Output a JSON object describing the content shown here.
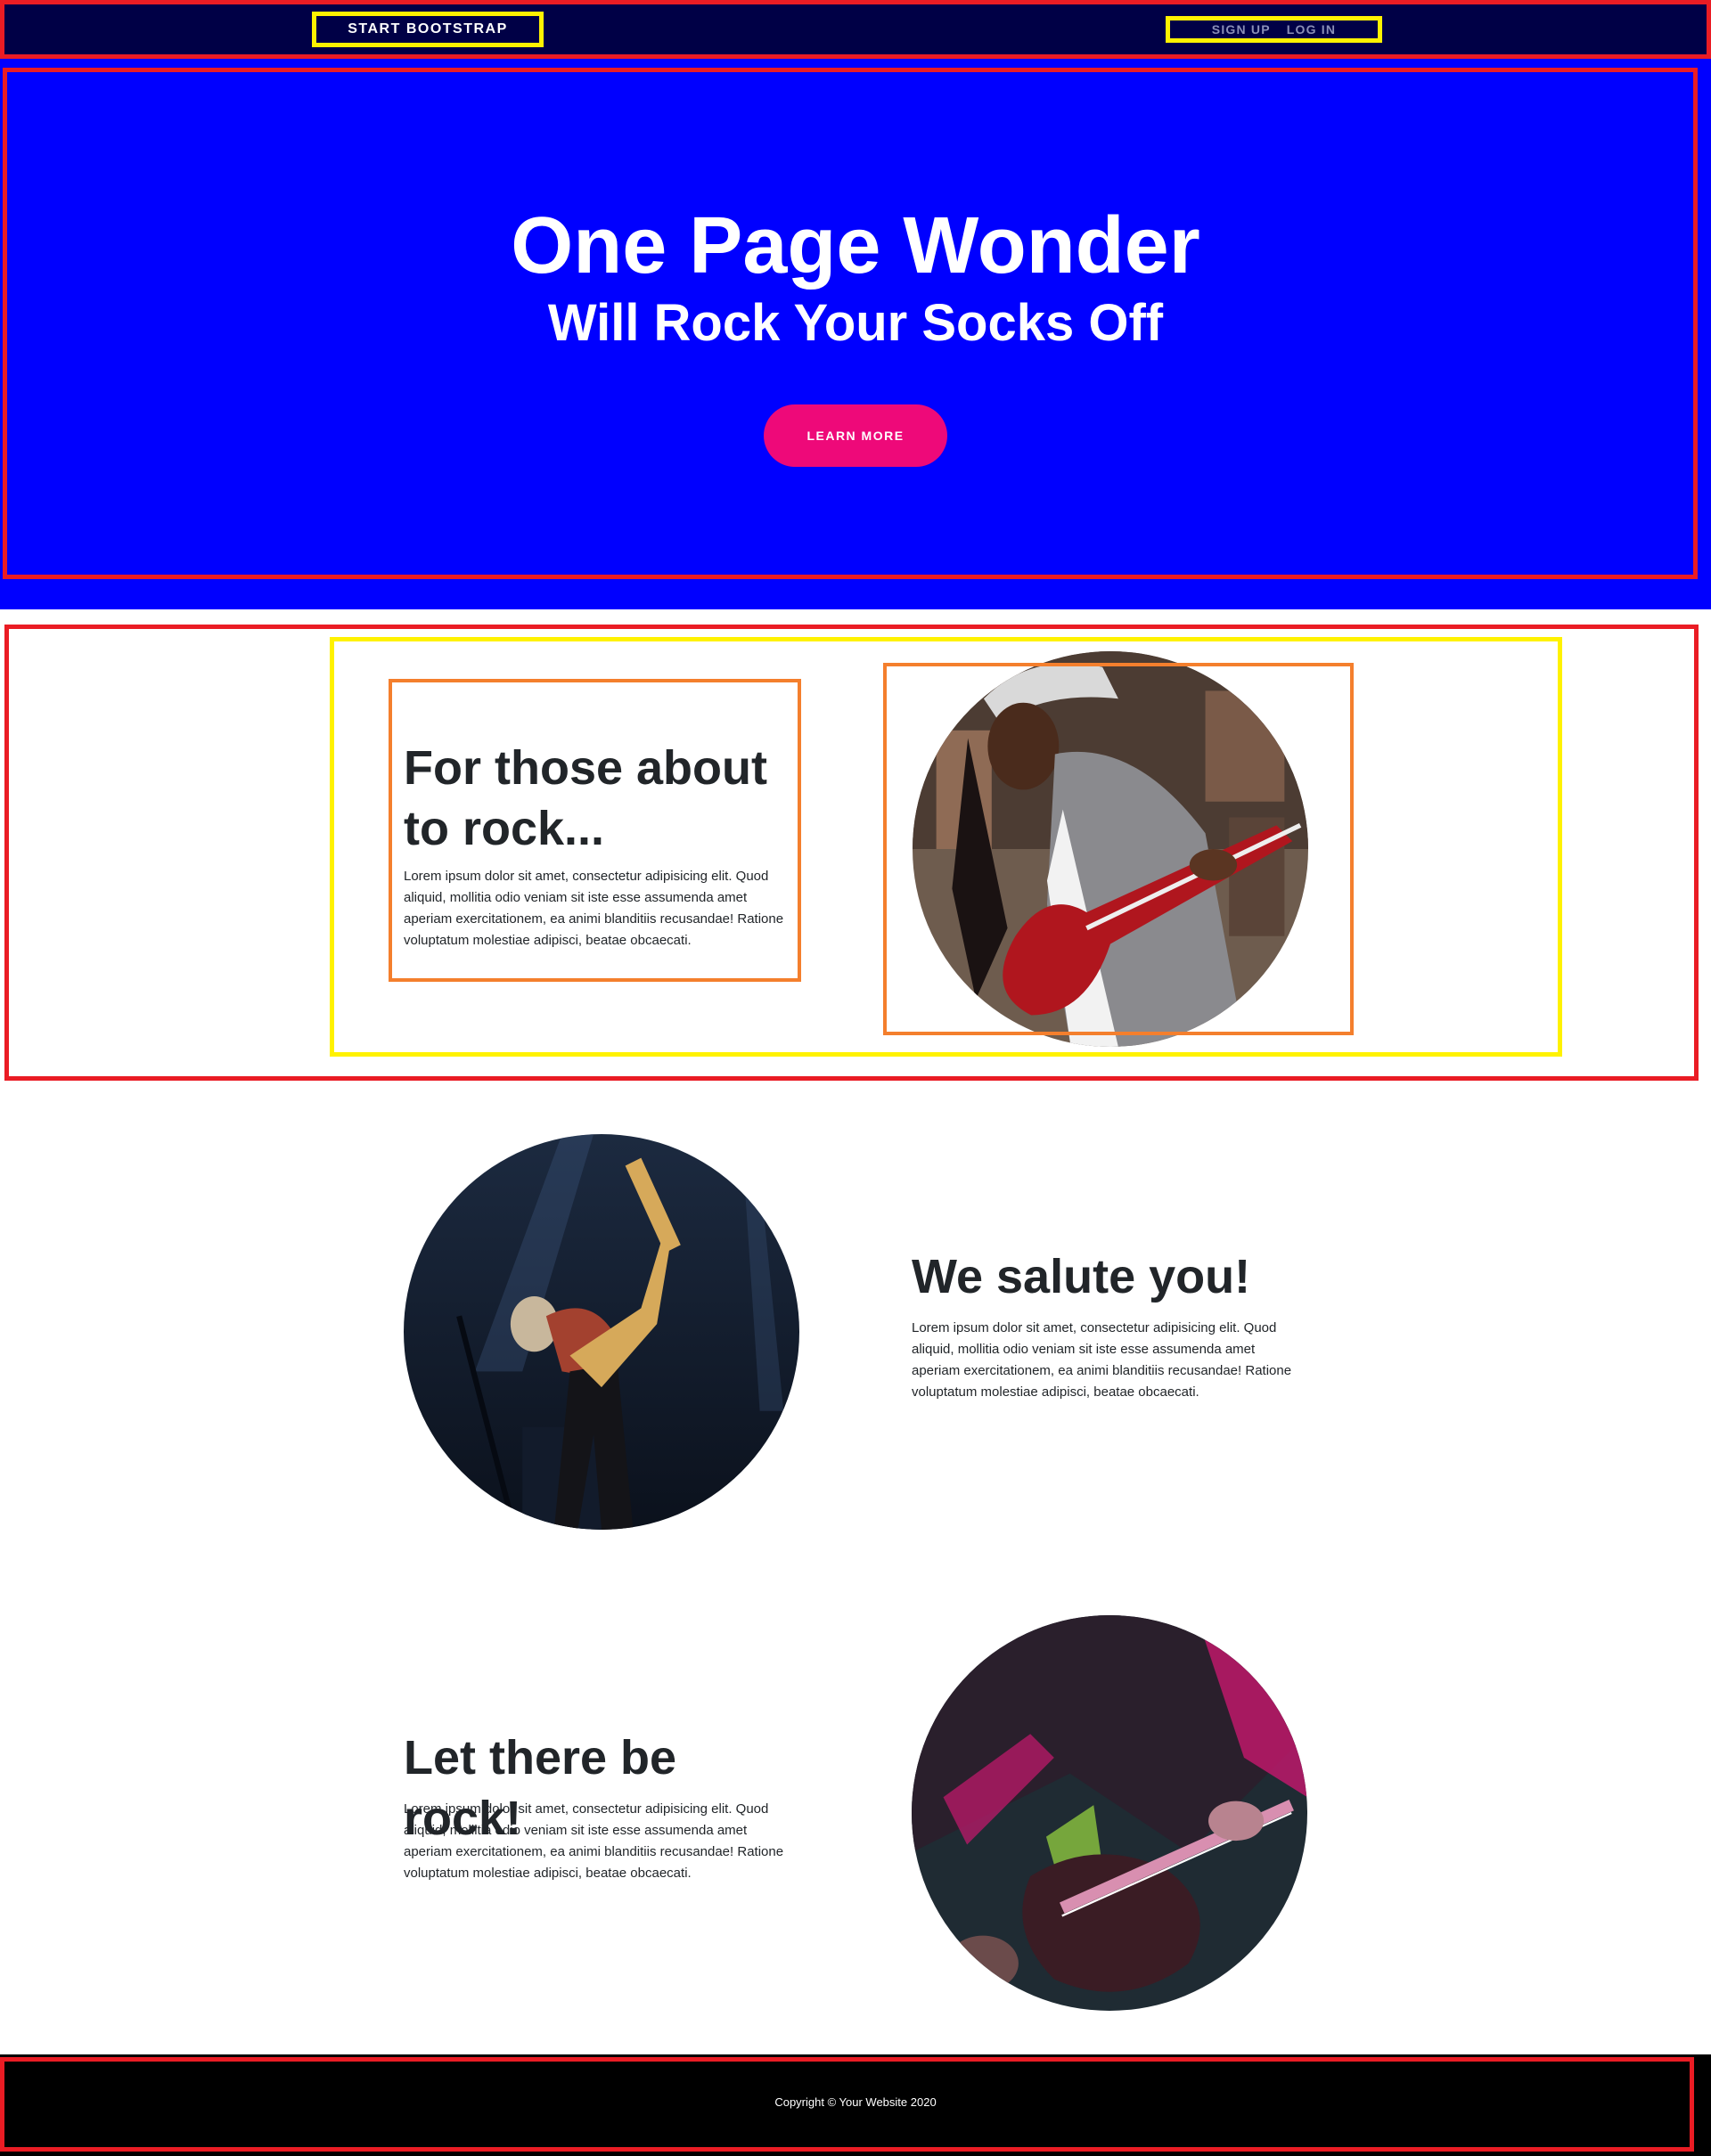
{
  "navbar": {
    "brand": "Start Bootstrap",
    "links": [
      {
        "label": "Sign Up"
      },
      {
        "label": "Log In"
      }
    ]
  },
  "hero": {
    "title": "One Page Wonder",
    "subtitle": "Will Rock Your Socks Off",
    "button_label": "Learn More"
  },
  "sections": [
    {
      "heading": "For those about to rock...",
      "text": "Lorem ipsum dolor sit amet, consectetur adipisicing elit. Quod aliquid, mollitia odio veniam sit iste esse assumenda amet aperiam exercitationem, ea animi blanditiis recusandae! Ratione voluptatum molestiae adipisci, beatae obcaecati."
    },
    {
      "heading": "We salute you!",
      "text": "Lorem ipsum dolor sit amet, consectetur adipisicing elit. Quod aliquid, mollitia odio veniam sit iste esse assumenda amet aperiam exercitationem, ea animi blanditiis recusandae! Ratione voluptatum molestiae adipisci, beatae obcaecati."
    },
    {
      "heading": "Let there be rock!",
      "text": "Lorem ipsum dolor sit amet, consectetur adipisicing elit. Quod aliquid, mollitia odio veniam sit iste esse assumenda amet aperiam exercitationem, ea animi blanditiis recusandae! Ratione voluptatum molestiae adipisci, beatae obcaecati."
    }
  ],
  "footer": {
    "copyright": "Copyright © Your Website 2020"
  },
  "colors": {
    "navbar_bg": "#000046",
    "hero_bg": "#0000ff",
    "button_bg": "#ee0979",
    "footer_bg": "#000000",
    "outline_red": "#ea1c24",
    "outline_yellow": "#fff200",
    "outline_orange": "#f47f2d"
  }
}
